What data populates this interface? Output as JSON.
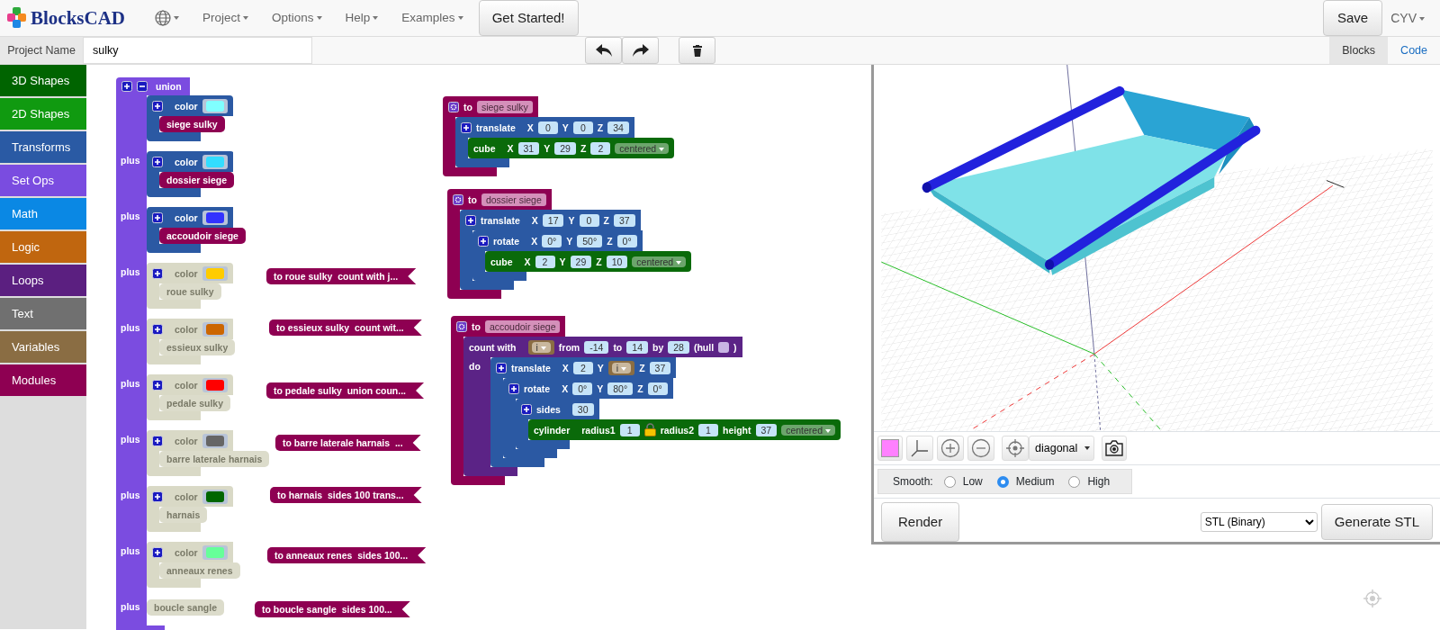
{
  "navbar": {
    "logo": "BlocksCAD",
    "menus": [
      {
        "label": "Project"
      },
      {
        "label": "Options"
      },
      {
        "label": "Help"
      },
      {
        "label": "Examples"
      }
    ],
    "get_started": "Get Started!",
    "save": "Save",
    "user": "CYV"
  },
  "project_bar": {
    "label": "Project Name",
    "value": "sulky",
    "view_tabs": [
      {
        "label": "Blocks",
        "selected": true
      },
      {
        "label": "Code",
        "selected": false
      }
    ]
  },
  "categories": [
    {
      "label": "3D Shapes",
      "color": "#006400"
    },
    {
      "label": "2D Shapes",
      "color": "#109a10"
    },
    {
      "label": "Transforms",
      "color": "#2a5aa4"
    },
    {
      "label": "Set Ops",
      "color": "#7a4ce0"
    },
    {
      "label": "Math",
      "color": "#0a88e4"
    },
    {
      "label": "Logic",
      "color": "#c0660f"
    },
    {
      "label": "Loops",
      "color": "#5b1f80"
    },
    {
      "label": "Text",
      "color": "#707070"
    },
    {
      "label": "Variables",
      "color": "#8a6d43"
    },
    {
      "label": "Modules",
      "color": "#8e0052"
    }
  ],
  "union": {
    "label": "union",
    "rows": [
      {
        "item": {
          "kind": "color",
          "label": "color",
          "color": "#80ffff",
          "disabled": false,
          "call": "siege sulky"
        }
      },
      {
        "sep": "plus",
        "item": {
          "kind": "color",
          "label": "color",
          "color": "#33ddff",
          "disabled": false,
          "call": "dossier siege"
        }
      },
      {
        "sep": "plus",
        "item": {
          "kind": "color",
          "label": "color",
          "color": "#3333ff",
          "disabled": false,
          "call": "accoudoir siege"
        }
      },
      {
        "sep": "plus",
        "item": {
          "kind": "color",
          "label": "color",
          "color": "#ffcc00",
          "disabled": true,
          "call": "roue sulky"
        }
      },
      {
        "sep": "plus",
        "item": {
          "kind": "color",
          "label": "color",
          "color": "#cc6600",
          "disabled": true,
          "call": "essieux sulky"
        }
      },
      {
        "sep": "plus",
        "item": {
          "kind": "color",
          "label": "color",
          "color": "#ff0000",
          "disabled": true,
          "call": "pedale sulky"
        }
      },
      {
        "sep": "plus",
        "item": {
          "kind": "color",
          "label": "color",
          "color": "#666666",
          "disabled": true,
          "call": "barre laterale harnais"
        }
      },
      {
        "sep": "plus",
        "item": {
          "kind": "color",
          "label": "color",
          "color": "#006600",
          "disabled": true,
          "call": "harnais"
        }
      },
      {
        "sep": "plus",
        "item": {
          "kind": "color",
          "label": "color",
          "color": "#66ff99",
          "disabled": true,
          "call": "anneaux renes"
        }
      },
      {
        "sep": "plus",
        "item": {
          "kind": "call",
          "label": "boucle sangle",
          "disabled": true
        }
      }
    ]
  },
  "collapsed_modules": [
    {
      "text": "to roue sulky  count with j..."
    },
    {
      "text": "to essieux sulky  count wit..."
    },
    {
      "text": "to pedale sulky  union coun..."
    },
    {
      "text": "to barre laterale harnais  ..."
    },
    {
      "text": "to harnais  sides 100 trans..."
    },
    {
      "text": "to anneaux renes  sides 100..."
    },
    {
      "text": "to boucle sangle  sides 100..."
    }
  ],
  "modules": [
    {
      "keyword": "to",
      "name": "siege sulky",
      "body": [
        {
          "kind": "transform",
          "label": "translate",
          "params": [
            {
              "name": "X",
              "value": "0"
            },
            {
              "name": "Y",
              "value": "0"
            },
            {
              "name": "Z",
              "value": "34"
            }
          ],
          "children": [
            {
              "kind": "shape",
              "label": "cube",
              "params": [
                {
                  "name": "X",
                  "value": "31"
                },
                {
                  "name": "Y",
                  "value": "29"
                },
                {
                  "name": "Z",
                  "value": "2"
                }
              ],
              "option": "centered"
            }
          ]
        }
      ]
    },
    {
      "keyword": "to",
      "name": "dossier siege",
      "body": [
        {
          "kind": "transform",
          "label": "translate",
          "params": [
            {
              "name": "X",
              "value": "17"
            },
            {
              "name": "Y",
              "value": "0"
            },
            {
              "name": "Z",
              "value": "37"
            }
          ],
          "children": [
            {
              "kind": "transform",
              "label": "rotate",
              "params": [
                {
                  "name": "X",
                  "value": "0°"
                },
                {
                  "name": "Y",
                  "value": "50°"
                },
                {
                  "name": "Z",
                  "value": "0°"
                }
              ],
              "children": [
                {
                  "kind": "shape",
                  "label": "cube",
                  "params": [
                    {
                      "name": "X",
                      "value": "2"
                    },
                    {
                      "name": "Y",
                      "value": "29"
                    },
                    {
                      "name": "Z",
                      "value": "10"
                    }
                  ],
                  "option": "centered"
                }
              ]
            }
          ]
        }
      ]
    },
    {
      "keyword": "to",
      "name": "accoudoir siege",
      "body": [
        {
          "kind": "loop",
          "label": "count with",
          "params": [
            {
              "kind": "var",
              "value": "i"
            },
            {
              "name": "from",
              "value": "-14"
            },
            {
              "name": "to",
              "value": "14"
            },
            {
              "name": "by",
              "value": "28"
            },
            {
              "name": "(hull",
              "kind": "check",
              "checked": false
            }
          ],
          "suffix": ")",
          "body_label": "do",
          "children": [
            {
              "kind": "transform",
              "label": "translate",
              "params": [
                {
                  "name": "X",
                  "value": "2"
                },
                {
                  "name": "Y",
                  "kind": "var",
                  "value": "i"
                },
                {
                  "name": "Z",
                  "value": "37"
                }
              ],
              "children": [
                {
                  "kind": "transform",
                  "label": "rotate",
                  "params": [
                    {
                      "name": "X",
                      "value": "0°"
                    },
                    {
                      "name": "Y",
                      "value": "80°"
                    },
                    {
                      "name": "Z",
                      "value": "0°"
                    }
                  ],
                  "children": [
                    {
                      "kind": "transform",
                      "label": "sides",
                      "params": [
                        {
                          "value": "30"
                        }
                      ],
                      "children": [
                        {
                          "kind": "shape",
                          "label": "cylinder",
                          "params": [
                            {
                              "name": "radius1",
                              "value": "1",
                              "locked": true
                            },
                            {
                              "name": "radius2",
                              "value": "1"
                            },
                            {
                              "name": "height",
                              "value": "37"
                            }
                          ],
                          "option": "centered"
                        }
                      ]
                    }
                  ]
                }
              ]
            }
          ]
        }
      ]
    }
  ],
  "viewer": {
    "color": "#ff80ff",
    "view": "diagonal",
    "smooth_label": "Smooth:",
    "smooth": [
      {
        "label": "Low",
        "selected": false
      },
      {
        "label": "Medium",
        "selected": true
      },
      {
        "label": "High",
        "selected": false
      }
    ],
    "render": "Render",
    "format": "STL (Binary)",
    "generate": "Generate STL"
  }
}
